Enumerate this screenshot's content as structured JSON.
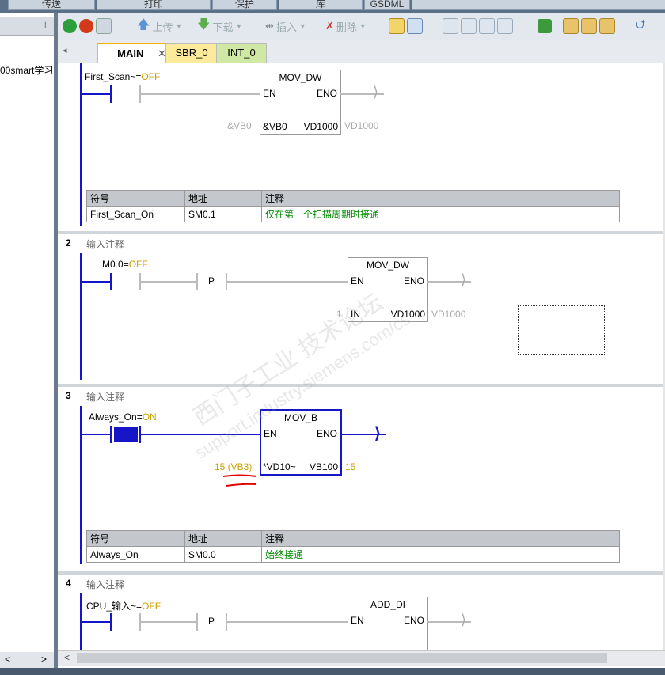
{
  "ribbon": {
    "tabs": [
      "传送",
      "打印",
      "保护",
      "库",
      "GSDML"
    ]
  },
  "left_pane": {
    "tree_item": "00smart学习",
    "pin_icon": "pin-icon",
    "nav_prev": "<",
    "nav_next": ">"
  },
  "toolbar": {
    "upload_label": "上传",
    "download_label": "下载",
    "insert_label": "插入",
    "delete_label": "删除"
  },
  "tabs": [
    {
      "label": "MAIN",
      "active": true,
      "close": "✕"
    },
    {
      "label": "SBR_0",
      "active": false
    },
    {
      "label": "INT_0",
      "active": false
    }
  ],
  "tab_nav": "◂",
  "symbol_headers": [
    "符号",
    "地址",
    "注释"
  ],
  "networks": [
    {
      "contact_label": "First_Scan",
      "contact_suffix": "~=",
      "contact_state": "OFF",
      "box_title": "MOV_DW",
      "en": "EN",
      "eno": "ENO",
      "in_label": "&VB0",
      "in_outside": "&VB0",
      "out_label": "VD1000",
      "out_outside": "VD1000",
      "symbols": [
        {
          "symbol": "First_Scan_On",
          "address": "SM0.1",
          "comment": "仅在第一个扫描周期时接通"
        }
      ]
    },
    {
      "number": "2",
      "comment": "输入注释",
      "contact_label": "M0.0",
      "contact_suffix": "=",
      "contact_state": "OFF",
      "p_label": "P",
      "box_title": "MOV_DW",
      "en": "EN",
      "eno": "ENO",
      "in_label": "IN",
      "in_outside": "1",
      "out_label": "VD1000",
      "out_outside": "VD1000"
    },
    {
      "number": "3",
      "comment": "输入注释",
      "contact_label": "Always_On",
      "contact_suffix": "=",
      "contact_state": "ON",
      "box_title": "MOV_B",
      "en": "EN",
      "eno": "ENO",
      "in_label": "*VD10~",
      "in_outside": "15 (VB3)",
      "out_label": "VB100",
      "out_outside": "15",
      "symbols": [
        {
          "symbol": "Always_On",
          "address": "SM0.0",
          "comment": "始终接通"
        }
      ]
    },
    {
      "number": "4",
      "comment": "输入注释",
      "contact_label": "CPU_输入",
      "contact_suffix": "~=",
      "contact_state": "OFF",
      "p_label": "P",
      "box_title": "ADD_DI",
      "en": "EN",
      "eno": "ENO"
    }
  ],
  "watermark": {
    "line1": "西门子工业 技术论坛",
    "line2": "support.industry.siemens.com/cs"
  },
  "colors": {
    "rail_blue": "#1616c8",
    "state_yellow": "#c8a000",
    "comment_green": "#008800",
    "annotation_red": "#e00000"
  }
}
